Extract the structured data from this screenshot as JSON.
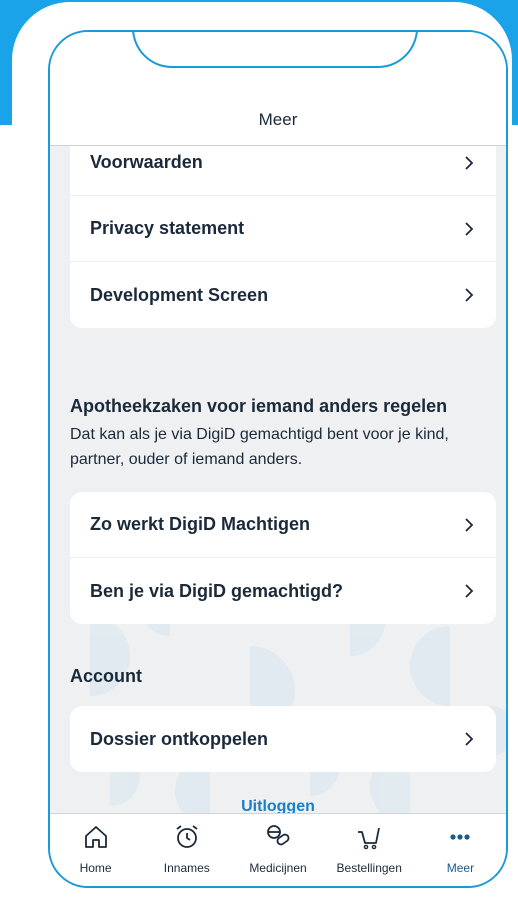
{
  "header": {
    "title": "Meer"
  },
  "card_top": {
    "items": [
      {
        "label": "Voorwaarden"
      },
      {
        "label": "Privacy statement"
      },
      {
        "label": "Development Screen"
      }
    ]
  },
  "section_apotheek": {
    "title": "Apotheekzaken voor iemand anders regelen",
    "description": "Dat kan als je via DigiD gemachtigd bent voor je kind, partner, ouder of iemand anders.",
    "items": [
      {
        "label": "Zo werkt DigiD Machtigen"
      },
      {
        "label": "Ben je via DigiD gemachtigd?"
      }
    ]
  },
  "section_account": {
    "title": "Account",
    "items": [
      {
        "label": "Dossier ontkoppelen"
      }
    ]
  },
  "logout_label": "Uitloggen",
  "tabs": [
    {
      "label": "Home",
      "icon": "home-icon"
    },
    {
      "label": "Innames",
      "icon": "alarm-clock-icon"
    },
    {
      "label": "Medicijnen",
      "icon": "pills-icon"
    },
    {
      "label": "Bestellingen",
      "icon": "cart-icon"
    },
    {
      "label": "Meer",
      "icon": "more-dots-icon",
      "active": true
    }
  ],
  "colors": {
    "brand_blue": "#1aa3e8",
    "link_blue": "#1a7fc8",
    "text_dark": "#1b2a3a",
    "background_grey": "#eef0f2"
  }
}
